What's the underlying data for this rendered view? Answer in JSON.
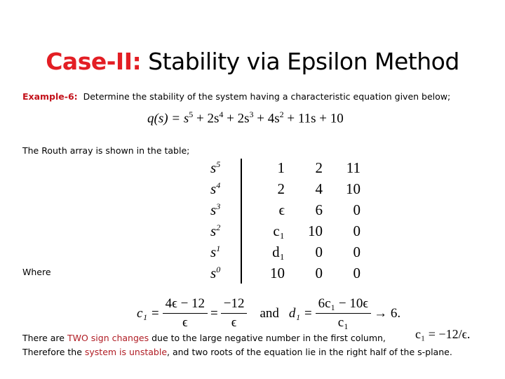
{
  "slide": {
    "title_prefix": "Case-II:",
    "title_rest": " Stability via Epsilon Method",
    "example_label": "Example-6:",
    "example_text": "Determine the stability of the system having a characteristic equation given below;",
    "equation": {
      "lhs": "q(s) = ",
      "terms": [
        "s",
        "5",
        " + 2s",
        "4",
        " + 2s",
        "3",
        " + 4s",
        "2",
        " + 11s + 10"
      ]
    },
    "routh_intro": "The Routh array is shown in the table;",
    "routh_table": [
      {
        "power": "s",
        "exp": "5",
        "cells": [
          "1",
          "2",
          "11"
        ]
      },
      {
        "power": "s",
        "exp": "4",
        "cells": [
          "2",
          "4",
          "10"
        ]
      },
      {
        "power": "s",
        "exp": "3",
        "cells": [
          "ϵ",
          "6",
          "0"
        ]
      },
      {
        "power": "s",
        "exp": "2",
        "cells": [
          "c₁",
          "10",
          "0"
        ]
      },
      {
        "power": "s",
        "exp": "1",
        "cells": [
          "d₁",
          "0",
          "0"
        ]
      },
      {
        "power": "s",
        "exp": "0",
        "cells": [
          "10",
          "0",
          "0"
        ]
      }
    ],
    "where_label": "Where",
    "formula": {
      "c1_lhs": "c₁ =",
      "c1_num": "4ϵ − 12",
      "c1_den": "ϵ",
      "eq": "=",
      "c1_num2": "−12",
      "c1_den2": "ϵ",
      "and": "and",
      "d1_lhs": "d₁ =",
      "d1_num": "6c₁ − 10ϵ",
      "d1_den": "c₁",
      "d1_limit": "→ 6."
    },
    "conclusion": {
      "line1_a": "There are ",
      "line1_highlight": "TWO sign changes",
      "line1_b": " due to the large negative number in the first column,",
      "line1_math": "c₁ = −12/ϵ.",
      "line2_a": "Therefore the ",
      "line2_highlight": "system is unstable",
      "line2_b": ", and two roots of the equation lie in the right half of the s-plane."
    }
  }
}
